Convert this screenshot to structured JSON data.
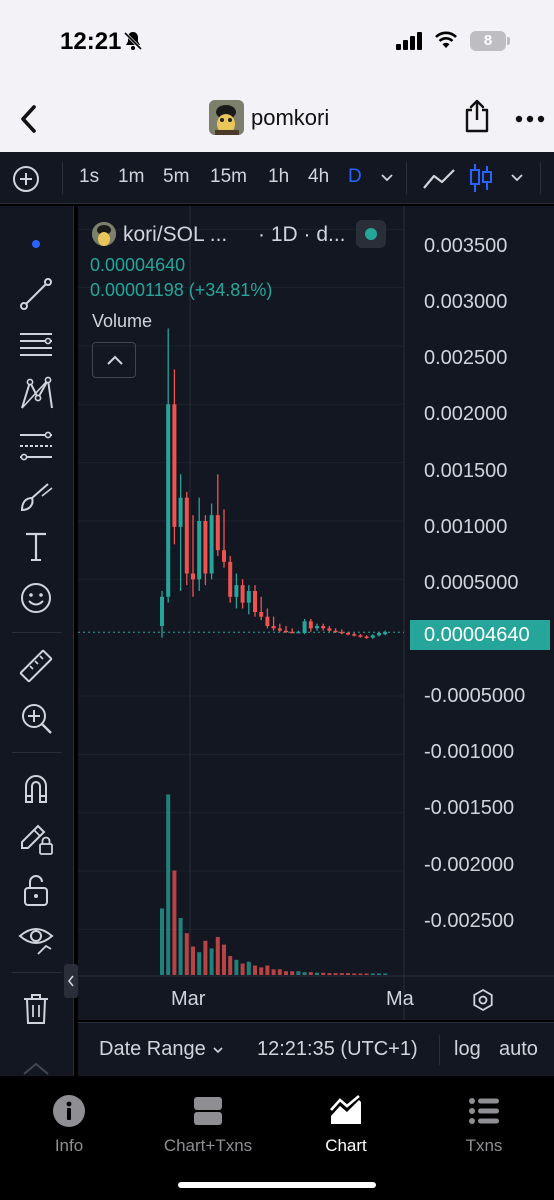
{
  "status_bar": {
    "time": "12:21",
    "battery": "8"
  },
  "header": {
    "token_name": "pomkori",
    "back_icon": "chevron-left-icon",
    "share_icon": "share-icon",
    "more_icon": "ellipsis-icon"
  },
  "toolbar": {
    "add_icon": "plus-circle-icon",
    "timeframes": [
      "1s",
      "1m",
      "5m",
      "15m",
      "1h",
      "4h",
      "D"
    ],
    "active_timeframe": "D",
    "line_chart_icon": "line-chart-icon",
    "candles_icon": "candlestick-icon"
  },
  "sidebar": {
    "tools": [
      "cursor-dot-icon",
      "trend-line-icon",
      "horizontal-lines-icon",
      "pattern-icon",
      "fib-icon",
      "brush-icon",
      "text-icon",
      "emoji-icon",
      "ruler-icon",
      "zoom-in-icon",
      "magnet-icon",
      "lock-pencil-icon",
      "unlock-icon",
      "eye-icon",
      "trash-icon"
    ]
  },
  "chart": {
    "legend": {
      "title": "kori/SOL ...",
      "interval": "· 1D · d...",
      "price": "0.00004640",
      "change": "0.00001198 (+34.81%)",
      "volume_label": "Volume"
    },
    "price_scale": [
      "0.003500",
      "0.003000",
      "0.002500",
      "0.002000",
      "0.001500",
      "0.001000",
      "0.0005000",
      "-0.0005000",
      "-0.001000",
      "-0.001500",
      "-0.002000",
      "-0.002500"
    ],
    "last_price_tag": "0.00004640",
    "time_axis": [
      "Mar",
      "Ma"
    ]
  },
  "chart_data": {
    "type": "candlestick",
    "title": "kori/SOL",
    "interval": "1D",
    "last_price": 4.64e-05,
    "change": 1.198e-05,
    "change_pct": 34.81,
    "ylim": [
      -0.0029,
      0.0037
    ],
    "yticks": [
      0.0035,
      0.003,
      0.0025,
      0.002,
      0.0015,
      0.001,
      0.0005,
      -0.0005,
      -0.001,
      -0.0015,
      -0.002,
      -0.0025
    ],
    "x_labels": [
      "Mar",
      "Ma"
    ],
    "colors": {
      "up": "#26a69a",
      "down": "#ef5350"
    },
    "candles": [
      {
        "o": 0.0001,
        "h": 0.0004,
        "l": 0.0,
        "c": 0.00035,
        "dir": "up"
      },
      {
        "o": 0.00035,
        "h": 0.00265,
        "l": 0.0003,
        "c": 0.002,
        "dir": "up"
      },
      {
        "o": 0.002,
        "h": 0.0023,
        "l": 0.0008,
        "c": 0.00095,
        "dir": "down"
      },
      {
        "o": 0.00095,
        "h": 0.0014,
        "l": 0.0004,
        "c": 0.0012,
        "dir": "up"
      },
      {
        "o": 0.0012,
        "h": 0.00125,
        "l": 0.00045,
        "c": 0.00055,
        "dir": "down"
      },
      {
        "o": 0.00055,
        "h": 0.00105,
        "l": 0.00035,
        "c": 0.0005,
        "dir": "down"
      },
      {
        "o": 0.0005,
        "h": 0.0012,
        "l": 0.0004,
        "c": 0.001,
        "dir": "up"
      },
      {
        "o": 0.001,
        "h": 0.00105,
        "l": 0.00045,
        "c": 0.00055,
        "dir": "down"
      },
      {
        "o": 0.00055,
        "h": 0.00115,
        "l": 0.0005,
        "c": 0.00105,
        "dir": "up"
      },
      {
        "o": 0.00105,
        "h": 0.0014,
        "l": 0.0007,
        "c": 0.00075,
        "dir": "down"
      },
      {
        "o": 0.00075,
        "h": 0.0011,
        "l": 0.0006,
        "c": 0.00065,
        "dir": "down"
      },
      {
        "o": 0.00065,
        "h": 0.0007,
        "l": 0.0003,
        "c": 0.00035,
        "dir": "down"
      },
      {
        "o": 0.00035,
        "h": 0.00055,
        "l": 0.00025,
        "c": 0.00045,
        "dir": "up"
      },
      {
        "o": 0.00045,
        "h": 0.0005,
        "l": 0.00025,
        "c": 0.0003,
        "dir": "down"
      },
      {
        "o": 0.0003,
        "h": 0.00045,
        "l": 0.0002,
        "c": 0.0004,
        "dir": "up"
      },
      {
        "o": 0.0004,
        "h": 0.00045,
        "l": 0.00018,
        "c": 0.00022,
        "dir": "down"
      },
      {
        "o": 0.00022,
        "h": 0.00035,
        "l": 0.00015,
        "c": 0.00018,
        "dir": "down"
      },
      {
        "o": 0.00018,
        "h": 0.00025,
        "l": 8e-05,
        "c": 0.0001,
        "dir": "down"
      },
      {
        "o": 0.0001,
        "h": 0.00018,
        "l": 6e-05,
        "c": 8e-05,
        "dir": "down"
      },
      {
        "o": 8e-05,
        "h": 0.00012,
        "l": 5e-05,
        "c": 6e-05,
        "dir": "down"
      },
      {
        "o": 6e-05,
        "h": 0.0001,
        "l": 4e-05,
        "c": 5e-05,
        "dir": "down"
      },
      {
        "o": 5e-05,
        "h": 8e-05,
        "l": 4e-05,
        "c": 4e-05,
        "dir": "down"
      },
      {
        "o": 4e-05,
        "h": 6e-05,
        "l": 4e-05,
        "c": 5e-05,
        "dir": "up"
      },
      {
        "o": 4e-05,
        "h": 0.00016,
        "l": 3e-05,
        "c": 0.00014,
        "dir": "up"
      },
      {
        "o": 0.00014,
        "h": 0.00016,
        "l": 5e-05,
        "c": 8e-05,
        "dir": "down"
      },
      {
        "o": 8e-05,
        "h": 0.00012,
        "l": 6e-05,
        "c": 0.0001,
        "dir": "up"
      },
      {
        "o": 0.0001,
        "h": 0.00012,
        "l": 6e-05,
        "c": 8e-05,
        "dir": "down"
      },
      {
        "o": 8e-05,
        "h": 0.0001,
        "l": 5e-05,
        "c": 6e-05,
        "dir": "down"
      },
      {
        "o": 6e-05,
        "h": 8e-05,
        "l": 4e-05,
        "c": 5e-05,
        "dir": "down"
      },
      {
        "o": 5e-05,
        "h": 7e-05,
        "l": 3e-05,
        "c": 4e-05,
        "dir": "down"
      },
      {
        "o": 4e-05,
        "h": 5e-05,
        "l": 2e-05,
        "c": 3e-05,
        "dir": "down"
      },
      {
        "o": 3e-05,
        "h": 4e-05,
        "l": 1e-05,
        "c": 2e-05,
        "dir": "down"
      },
      {
        "o": 2e-05,
        "h": 3e-05,
        "l": 0.0,
        "c": 1e-05,
        "dir": "down"
      },
      {
        "o": 1e-05,
        "h": 2e-05,
        "l": -1e-05,
        "c": 0.0,
        "dir": "down"
      },
      {
        "o": 0.0,
        "h": 3e-05,
        "l": -1e-05,
        "c": 2e-05,
        "dir": "up"
      },
      {
        "o": 2e-05,
        "h": 5e-05,
        "l": 1e-05,
        "c": 4e-05,
        "dir": "up"
      },
      {
        "o": 3e-05,
        "h": 6e-05,
        "l": 2e-05,
        "c": 4.64e-05,
        "dir": "up"
      }
    ],
    "volume": [
      0.35,
      0.95,
      0.55,
      0.3,
      0.22,
      0.15,
      0.12,
      0.18,
      0.14,
      0.2,
      0.16,
      0.1,
      0.08,
      0.06,
      0.07,
      0.05,
      0.04,
      0.05,
      0.03,
      0.03,
      0.02,
      0.02,
      0.02,
      0.015,
      0.015,
      0.012,
      0.012,
      0.01,
      0.01,
      0.01,
      0.01,
      0.008,
      0.008,
      0.008,
      0.008,
      0.008,
      0.008
    ]
  },
  "bottom_bar": {
    "date_range": "Date Range",
    "time": "12:21:35 (UTC+1)",
    "log": "log",
    "auto": "auto"
  },
  "tabs": [
    {
      "label": "Info",
      "icon": "info-icon"
    },
    {
      "label": "Chart+Txns",
      "icon": "split-view-icon"
    },
    {
      "label": "Chart",
      "icon": "area-chart-icon",
      "active": true
    },
    {
      "label": "Txns",
      "icon": "list-icon"
    }
  ]
}
